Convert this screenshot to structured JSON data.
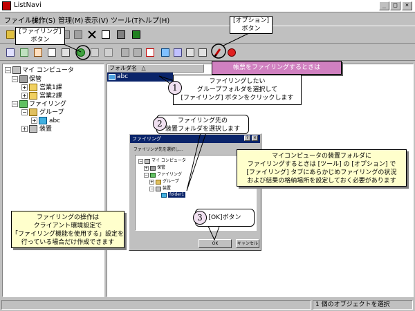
{
  "window": {
    "title": "ListNavi",
    "minimize": "_",
    "maximize": "□",
    "close": "×"
  },
  "menu": [
    "ファイル(F)",
    "操作(S)",
    "管理(M)",
    "表示(V)",
    "ツール(T)",
    "ヘルプ(H)"
  ],
  "tree": {
    "root": "マイ コンピュータ",
    "hokan": "保管",
    "eigyo1": "営業1課",
    "eigyo2": "営業2課",
    "filing": "ファイリング",
    "group": "グループ",
    "abc": "abc",
    "device": "装置"
  },
  "list": {
    "column": "フォルダ名",
    "sort_glyph": "△",
    "selected_item": "abc"
  },
  "status": {
    "left": "",
    "right": "1 個のオブジェクトを選択"
  },
  "dialog": {
    "title": "ファイリング",
    "help": "?",
    "close": "×",
    "label": "ファイリング先を選択し...",
    "tree": {
      "root": "マイ コンピュータ",
      "hokan": "保管",
      "filing": "ファイリング",
      "group": "グループ",
      "device": "装置",
      "folder": "folder1"
    },
    "ok": "OK",
    "cancel": "キャンセル"
  },
  "callouts": {
    "filing_button": "[ファイリング]\nボタン",
    "option_button": "[オプション]\nボタン",
    "banner": "帳票をファイリングするときは",
    "step1_num": "1",
    "step1_text": "ファイリングしたい\nグループフォルダを選択して\n[ファイリング] ボタンをクリックします",
    "step2_num": "2",
    "step2_text": "ファイリング先の\n装置フォルダを選択します",
    "step3_num": "3",
    "step3_text": "[OK]ボタン",
    "note_right": "マイコンピュータの装置フォルダに\nファイリングするときは [ツール] の [オプション] で\n[ファイリング] タブにあらかじめファイリングの状況\nおよび結果の格納場所を設定しておく必要があります",
    "note_left": "ファイリングの操作は\nクライアント環境設定で\n「ファイリング機能を使用する」設定を\n行っている場合だけ作成できます"
  },
  "colors": {
    "selection": "#0a246a",
    "banner": "#d080c0",
    "note": "#ffffcc",
    "circle": "#f0e0f0"
  }
}
